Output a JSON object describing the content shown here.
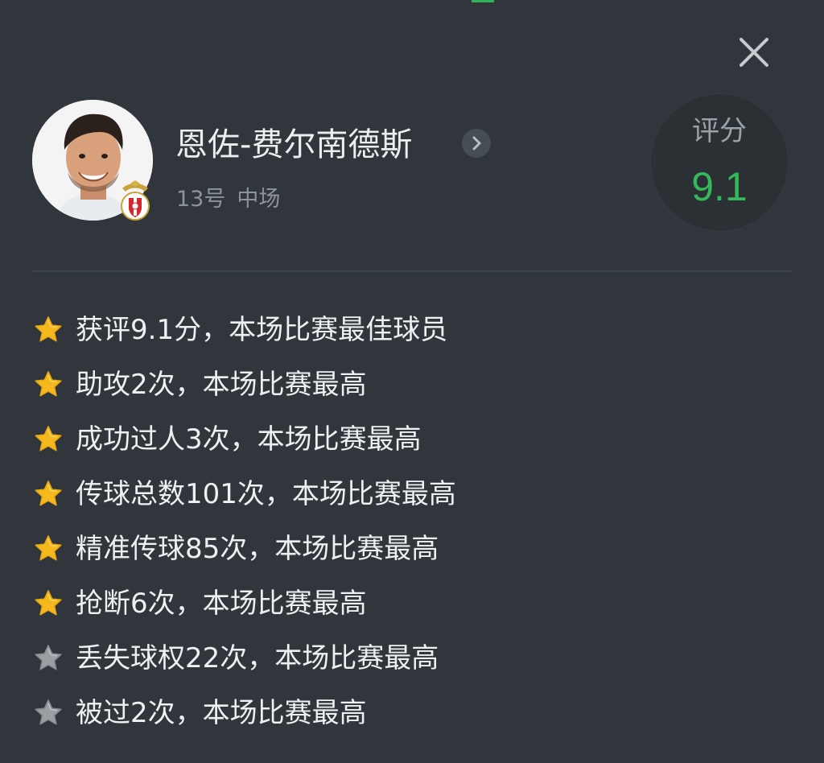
{
  "player": {
    "name": "恩佐-费尔南德斯",
    "number": "13号",
    "position": "中场"
  },
  "rating": {
    "label": "评分",
    "value": "9.1"
  },
  "colors": {
    "background": "#30363b",
    "rating_green": "#35b85a",
    "gold_star": "#f5b91e",
    "grey_star": "#9a9fa4"
  },
  "icons": {
    "close": "close-icon",
    "arrow": "chevron-right-icon",
    "gold_star": "gold-star-icon",
    "grey_star": "grey-star-icon",
    "club": "club-badge-icon"
  },
  "highlights": [
    {
      "text": "获评9.1分，本场比赛最佳球员",
      "star": "gold"
    },
    {
      "text": "助攻2次，本场比赛最高",
      "star": "gold"
    },
    {
      "text": "成功过人3次，本场比赛最高",
      "star": "gold"
    },
    {
      "text": "传球总数101次，本场比赛最高",
      "star": "gold"
    },
    {
      "text": "精准传球85次，本场比赛最高",
      "star": "gold"
    },
    {
      "text": "抢断6次，本场比赛最高",
      "star": "gold"
    },
    {
      "text": "丢失球权22次，本场比赛最高",
      "star": "grey"
    },
    {
      "text": "被过2次，本场比赛最高",
      "star": "grey"
    }
  ]
}
